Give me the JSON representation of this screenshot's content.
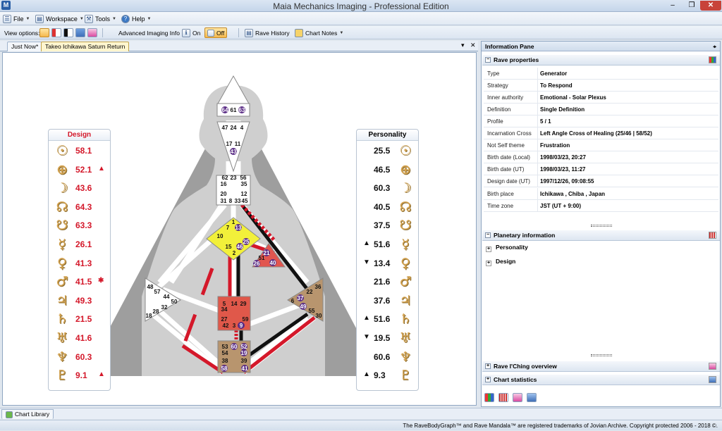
{
  "window": {
    "title": "Maia Mechanics Imaging - Professional Edition",
    "app_icon": "M",
    "min": "–",
    "max": "❒",
    "close": "✕"
  },
  "menu": {
    "file": "File",
    "workspace": "Workspace",
    "tools": "Tools",
    "help": "Help"
  },
  "toolbar": {
    "view_options": "View options:",
    "advanced_info": "Advanced Imaging Info :",
    "on": "On",
    "off": "Off",
    "rave_history": "Rave History",
    "chart_notes": "Chart Notes"
  },
  "tabs": {
    "just_now": "Just Now*",
    "chart": "Takeo Ichikawa Saturn Return",
    "pin": "▾",
    "close": "✕"
  },
  "design_panel": {
    "title": "Design",
    "rows": [
      {
        "glyph": "☉",
        "value": "58.1",
        "mark": ""
      },
      {
        "glyph": "⊕",
        "value": "52.1",
        "mark": "▲"
      },
      {
        "glyph": "☽",
        "value": "43.6",
        "mark": ""
      },
      {
        "glyph": "☊",
        "value": "64.3",
        "mark": ""
      },
      {
        "glyph": "☋",
        "value": "63.3",
        "mark": ""
      },
      {
        "glyph": "☿",
        "value": "26.1",
        "mark": ""
      },
      {
        "glyph": "♀",
        "value": "41.3",
        "mark": ""
      },
      {
        "glyph": "♂",
        "value": "41.5",
        "mark": "✱"
      },
      {
        "glyph": "♃",
        "value": "49.3",
        "mark": ""
      },
      {
        "glyph": "♄",
        "value": "21.5",
        "mark": ""
      },
      {
        "glyph": "♅",
        "value": "41.6",
        "mark": ""
      },
      {
        "glyph": "♆",
        "value": "60.3",
        "mark": ""
      },
      {
        "glyph": "♇",
        "value": "9.1",
        "mark": "▲"
      }
    ]
  },
  "personality_panel": {
    "title": "Personality",
    "rows": [
      {
        "glyph": "☉",
        "value": "25.5",
        "mark": ""
      },
      {
        "glyph": "⊕",
        "value": "46.5",
        "mark": ""
      },
      {
        "glyph": "☽",
        "value": "60.3",
        "mark": ""
      },
      {
        "glyph": "☊",
        "value": "40.5",
        "mark": ""
      },
      {
        "glyph": "☋",
        "value": "37.5",
        "mark": ""
      },
      {
        "glyph": "☿",
        "value": "51.6",
        "mark": "▲"
      },
      {
        "glyph": "♀",
        "value": "13.4",
        "mark": "▼"
      },
      {
        "glyph": "♂",
        "value": "21.6",
        "mark": ""
      },
      {
        "glyph": "♃",
        "value": "37.6",
        "mark": ""
      },
      {
        "glyph": "♄",
        "value": "51.6",
        "mark": "▲"
      },
      {
        "glyph": "♅",
        "value": "19.5",
        "mark": "▼"
      },
      {
        "glyph": "♆",
        "value": "60.6",
        "mark": ""
      },
      {
        "glyph": "♇",
        "value": "9.3",
        "mark": "▲"
      }
    ]
  },
  "bodygraph": {
    "head": [
      "64",
      "61",
      "63"
    ],
    "ajna_top": [
      "47",
      "24",
      "4"
    ],
    "ajna_bottom": [
      "17",
      "11",
      "43"
    ],
    "throat": [
      "62",
      "23",
      "56",
      "16",
      "35",
      "20",
      "12",
      "31",
      "8",
      "33",
      "45"
    ],
    "g": [
      "1",
      "7",
      "13",
      "10",
      "15",
      "46",
      "25",
      "2"
    ],
    "ego": [
      "21",
      "51",
      "26",
      "40"
    ],
    "spleen": [
      "48",
      "57",
      "44",
      "50",
      "32",
      "28",
      "18"
    ],
    "sacral": [
      "5",
      "14",
      "29",
      "34",
      "27",
      "59",
      "42",
      "3",
      "9"
    ],
    "solar": [
      "36",
      "22",
      "37",
      "6",
      "49",
      "55",
      "30"
    ],
    "root": [
      "53",
      "60",
      "52",
      "54",
      "19",
      "38",
      "39",
      "58",
      "41"
    ]
  },
  "info_pane": {
    "title": "Information Pane",
    "pin": "⌖",
    "rave_properties": "Rave properties",
    "properties": [
      {
        "key": "Type",
        "value": "Generator"
      },
      {
        "key": "Strategy",
        "value": "To Respond"
      },
      {
        "key": "Inner authority",
        "value": "Emotional - Solar Plexus"
      },
      {
        "key": "Definition",
        "value": "Single Definition"
      },
      {
        "key": "Profile",
        "value": "5 / 1"
      },
      {
        "key": "Incarnation Cross",
        "value": "Left Angle Cross of Healing (25/46 | 58/52)"
      },
      {
        "key": "Not Self theme",
        "value": "Frustration"
      },
      {
        "key": "Birth date (Local)",
        "value": "1998/03/23, 20:27"
      },
      {
        "key": "Birth date (UT)",
        "value": "1998/03/23, 11:27"
      },
      {
        "key": "Design date (UT)",
        "value": "1997/12/26, 09:08:55"
      },
      {
        "key": "Birth place",
        "value": "Ichikawa , Chiba , Japan"
      },
      {
        "key": "Time zone",
        "value": "JST (UT + 9:00)"
      }
    ],
    "planetary_information": "Planetary information",
    "tree_personality": "Personality",
    "tree_design": "Design",
    "iching": "Rave I'Ching overview",
    "stats": "Chart statistics",
    "expander_open": "−",
    "expander_closed": "+"
  },
  "bottom": {
    "chart_library": "Chart Library",
    "copyright": "The RaveBodyGraph™ and Rave Mandala™ are registered trademarks of Jovian Archive. Copyright protected 2006 - 2018 ©."
  },
  "colors": {
    "design_red": "#d4182a",
    "personality_black": "#111111",
    "glyph_gold": "#d4a350",
    "g_center": "#f2f03a",
    "sacral": "#e0584a",
    "ego": "#e1564f",
    "solar_root": "#b8956e"
  }
}
